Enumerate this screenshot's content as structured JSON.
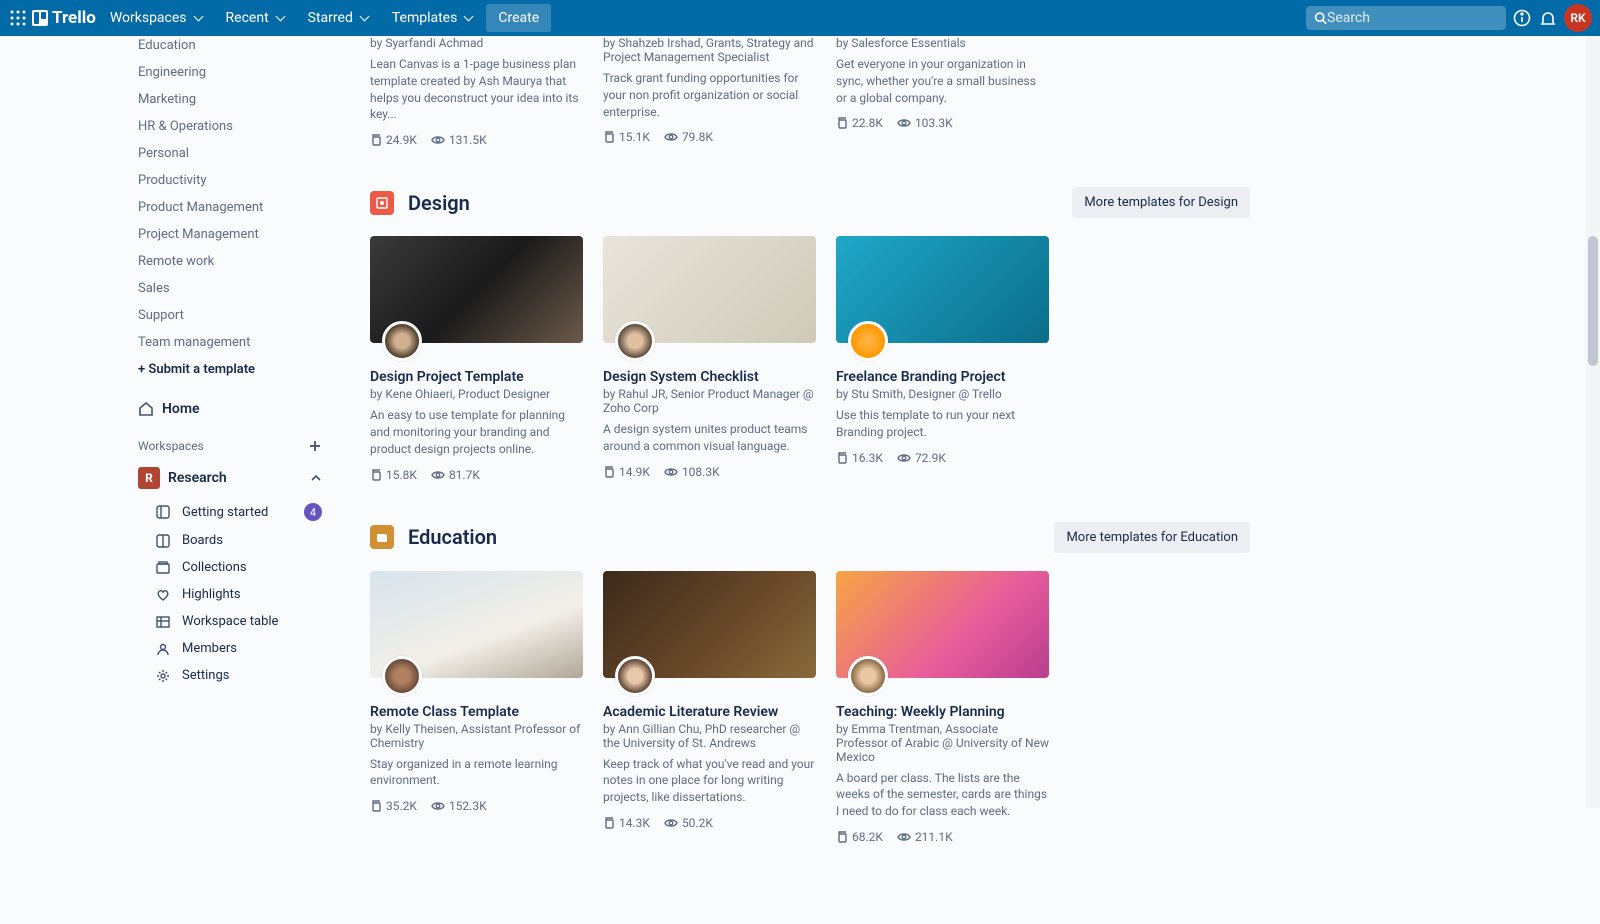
{
  "topbar": {
    "brand": "Trello",
    "menus": [
      "Workspaces",
      "Recent",
      "Starred",
      "Templates"
    ],
    "create": "Create",
    "search_placeholder": "Search",
    "avatar_initials": "RK"
  },
  "sidebar": {
    "categories": [
      "Education",
      "Engineering",
      "Marketing",
      "HR & Operations",
      "Personal",
      "Productivity",
      "Product Management",
      "Project Management",
      "Remote work",
      "Sales",
      "Support",
      "Team management"
    ],
    "submit": "+ Submit a template",
    "home": "Home",
    "workspaces_label": "Workspaces",
    "workspace": {
      "initial": "R",
      "name": "Research",
      "items": [
        {
          "icon": "board",
          "label": "Getting started",
          "badge": "4"
        },
        {
          "icon": "boards",
          "label": "Boards"
        },
        {
          "icon": "collections",
          "label": "Collections"
        },
        {
          "icon": "heart",
          "label": "Highlights"
        },
        {
          "icon": "table",
          "label": "Workspace table"
        },
        {
          "icon": "members",
          "label": "Members"
        },
        {
          "icon": "gear",
          "label": "Settings"
        }
      ]
    }
  },
  "top_row": [
    {
      "author": "by Syarfandi Achmad",
      "desc": "Lean Canvas is a 1-page business plan template created by Ash Maurya that helps you deconstruct your idea into its key...",
      "copies": "24.9K",
      "views": "131.5K"
    },
    {
      "author": "by Shahzeb Irshad, Grants, Strategy and Project Management Specialist",
      "desc": "Track grant funding opportunities for your non profit organization or social enterprise.",
      "copies": "15.1K",
      "views": "79.8K"
    },
    {
      "author": "by Salesforce Essentials",
      "desc": "Get everyone in your organization in sync, whether you're a small business or a global company.",
      "copies": "22.8K",
      "views": "103.3K"
    }
  ],
  "sections": {
    "design": {
      "title": "Design",
      "more": "More templates for Design",
      "cards": [
        {
          "title": "Design Project Template",
          "author": "by Kene Ohiaeri, Product Designer",
          "desc": "An easy to use template for planning and monitoring your branding and product design projects online.",
          "copies": "15.8K",
          "views": "81.7K"
        },
        {
          "title": "Design System Checklist",
          "author": "by Rahul JR, Senior Product Manager @ Zoho Corp",
          "desc": "A design system unites product teams around a common visual language.",
          "copies": "14.9K",
          "views": "108.3K"
        },
        {
          "title": "Freelance Branding Project",
          "author": "by Stu Smith, Designer @ Trello",
          "desc": "Use this template to run your next Branding project.",
          "copies": "16.3K",
          "views": "72.9K"
        }
      ]
    },
    "education": {
      "title": "Education",
      "more": "More templates for Education",
      "cards": [
        {
          "title": "Remote Class Template",
          "author": "by Kelly Theisen, Assistant Professor of Chemistry",
          "desc": "Stay organized in a remote learning environment.",
          "copies": "35.2K",
          "views": "152.3K"
        },
        {
          "title": "Academic Literature Review",
          "author": "by Ann Gillian Chu, PhD researcher @ the University of St. Andrews",
          "desc": "Keep track of what you've read and your notes in one place for long writing projects, like dissertations.",
          "copies": "14.3K",
          "views": "50.2K"
        },
        {
          "title": "Teaching: Weekly Planning",
          "author": "by Emma Trentman, Associate Professor of Arabic @ University of New Mexico",
          "desc": "A board per class. The lists are the weeks of the semester, cards are things I need to do for class each week.",
          "copies": "68.2K",
          "views": "211.1K"
        }
      ]
    }
  }
}
